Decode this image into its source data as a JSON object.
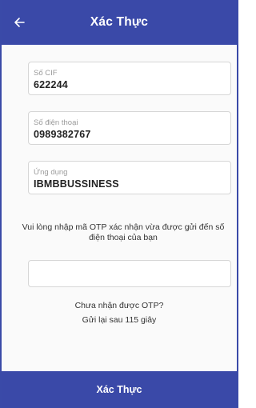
{
  "header": {
    "title": "Xác Thực",
    "back_icon": "arrow-left-icon"
  },
  "fields": {
    "cif": {
      "label": "Số CIF",
      "value": "622244"
    },
    "phone": {
      "label": "Số điện thoại",
      "value": "0989382767"
    },
    "app": {
      "label": "Ứng dụng",
      "value": "IBMBBUSSINESS"
    }
  },
  "instruction": "Vui lòng nhập mã OTP xác nhận vừa được gửi đến số điện thoại của bạn",
  "otp_input": {
    "value": "",
    "placeholder": ""
  },
  "resend": {
    "not_received": "Chưa nhận được OTP?",
    "countdown": "Gửi lại sau 115 giây"
  },
  "footer": {
    "submit_label": "Xác Thực"
  },
  "colors": {
    "primary": "#3a49a8",
    "border": "#d6d6d6",
    "label": "#9a9a9a"
  }
}
